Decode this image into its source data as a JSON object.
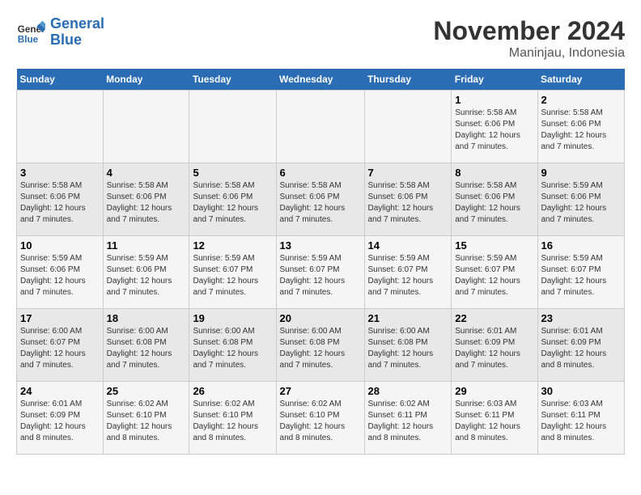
{
  "logo": {
    "name1": "General",
    "name2": "Blue"
  },
  "title": "November 2024",
  "location": "Maninjau, Indonesia",
  "days_of_week": [
    "Sunday",
    "Monday",
    "Tuesday",
    "Wednesday",
    "Thursday",
    "Friday",
    "Saturday"
  ],
  "weeks": [
    [
      {
        "day": "",
        "info": ""
      },
      {
        "day": "",
        "info": ""
      },
      {
        "day": "",
        "info": ""
      },
      {
        "day": "",
        "info": ""
      },
      {
        "day": "",
        "info": ""
      },
      {
        "day": "1",
        "info": "Sunrise: 5:58 AM\nSunset: 6:06 PM\nDaylight: 12 hours and 7 minutes."
      },
      {
        "day": "2",
        "info": "Sunrise: 5:58 AM\nSunset: 6:06 PM\nDaylight: 12 hours and 7 minutes."
      }
    ],
    [
      {
        "day": "3",
        "info": "Sunrise: 5:58 AM\nSunset: 6:06 PM\nDaylight: 12 hours and 7 minutes."
      },
      {
        "day": "4",
        "info": "Sunrise: 5:58 AM\nSunset: 6:06 PM\nDaylight: 12 hours and 7 minutes."
      },
      {
        "day": "5",
        "info": "Sunrise: 5:58 AM\nSunset: 6:06 PM\nDaylight: 12 hours and 7 minutes."
      },
      {
        "day": "6",
        "info": "Sunrise: 5:58 AM\nSunset: 6:06 PM\nDaylight: 12 hours and 7 minutes."
      },
      {
        "day": "7",
        "info": "Sunrise: 5:58 AM\nSunset: 6:06 PM\nDaylight: 12 hours and 7 minutes."
      },
      {
        "day": "8",
        "info": "Sunrise: 5:58 AM\nSunset: 6:06 PM\nDaylight: 12 hours and 7 minutes."
      },
      {
        "day": "9",
        "info": "Sunrise: 5:59 AM\nSunset: 6:06 PM\nDaylight: 12 hours and 7 minutes."
      }
    ],
    [
      {
        "day": "10",
        "info": "Sunrise: 5:59 AM\nSunset: 6:06 PM\nDaylight: 12 hours and 7 minutes."
      },
      {
        "day": "11",
        "info": "Sunrise: 5:59 AM\nSunset: 6:06 PM\nDaylight: 12 hours and 7 minutes."
      },
      {
        "day": "12",
        "info": "Sunrise: 5:59 AM\nSunset: 6:07 PM\nDaylight: 12 hours and 7 minutes."
      },
      {
        "day": "13",
        "info": "Sunrise: 5:59 AM\nSunset: 6:07 PM\nDaylight: 12 hours and 7 minutes."
      },
      {
        "day": "14",
        "info": "Sunrise: 5:59 AM\nSunset: 6:07 PM\nDaylight: 12 hours and 7 minutes."
      },
      {
        "day": "15",
        "info": "Sunrise: 5:59 AM\nSunset: 6:07 PM\nDaylight: 12 hours and 7 minutes."
      },
      {
        "day": "16",
        "info": "Sunrise: 5:59 AM\nSunset: 6:07 PM\nDaylight: 12 hours and 7 minutes."
      }
    ],
    [
      {
        "day": "17",
        "info": "Sunrise: 6:00 AM\nSunset: 6:07 PM\nDaylight: 12 hours and 7 minutes."
      },
      {
        "day": "18",
        "info": "Sunrise: 6:00 AM\nSunset: 6:08 PM\nDaylight: 12 hours and 7 minutes."
      },
      {
        "day": "19",
        "info": "Sunrise: 6:00 AM\nSunset: 6:08 PM\nDaylight: 12 hours and 7 minutes."
      },
      {
        "day": "20",
        "info": "Sunrise: 6:00 AM\nSunset: 6:08 PM\nDaylight: 12 hours and 7 minutes."
      },
      {
        "day": "21",
        "info": "Sunrise: 6:00 AM\nSunset: 6:08 PM\nDaylight: 12 hours and 7 minutes."
      },
      {
        "day": "22",
        "info": "Sunrise: 6:01 AM\nSunset: 6:09 PM\nDaylight: 12 hours and 7 minutes."
      },
      {
        "day": "23",
        "info": "Sunrise: 6:01 AM\nSunset: 6:09 PM\nDaylight: 12 hours and 8 minutes."
      }
    ],
    [
      {
        "day": "24",
        "info": "Sunrise: 6:01 AM\nSunset: 6:09 PM\nDaylight: 12 hours and 8 minutes."
      },
      {
        "day": "25",
        "info": "Sunrise: 6:02 AM\nSunset: 6:10 PM\nDaylight: 12 hours and 8 minutes."
      },
      {
        "day": "26",
        "info": "Sunrise: 6:02 AM\nSunset: 6:10 PM\nDaylight: 12 hours and 8 minutes."
      },
      {
        "day": "27",
        "info": "Sunrise: 6:02 AM\nSunset: 6:10 PM\nDaylight: 12 hours and 8 minutes."
      },
      {
        "day": "28",
        "info": "Sunrise: 6:02 AM\nSunset: 6:11 PM\nDaylight: 12 hours and 8 minutes."
      },
      {
        "day": "29",
        "info": "Sunrise: 6:03 AM\nSunset: 6:11 PM\nDaylight: 12 hours and 8 minutes."
      },
      {
        "day": "30",
        "info": "Sunrise: 6:03 AM\nSunset: 6:11 PM\nDaylight: 12 hours and 8 minutes."
      }
    ]
  ]
}
